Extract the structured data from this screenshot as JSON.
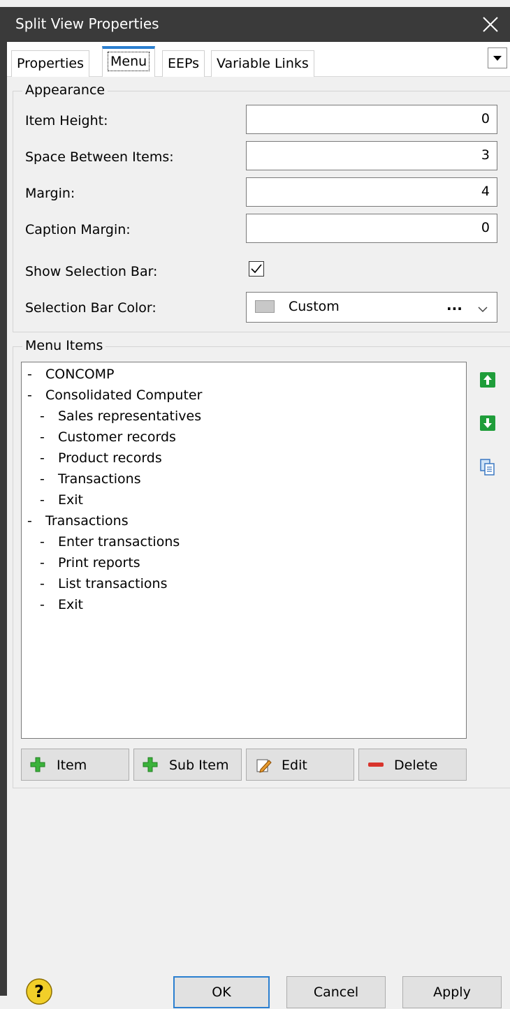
{
  "window": {
    "title": "Split View Properties"
  },
  "tabs": [
    {
      "label": "Properties"
    },
    {
      "label": "Menu"
    },
    {
      "label": "EEPs"
    },
    {
      "label": "Variable Links"
    }
  ],
  "appearance": {
    "group_label": "Appearance",
    "item_height": {
      "label": "Item Height:",
      "value": "0"
    },
    "space_between": {
      "label": "Space Between Items:",
      "value": "3"
    },
    "margin": {
      "label": "Margin:",
      "value": "4"
    },
    "caption_margin": {
      "label": "Caption Margin:",
      "value": "0"
    },
    "show_selection_bar": {
      "label": "Show Selection Bar:",
      "checked": true
    },
    "selection_bar_color": {
      "label": "Selection Bar Color:",
      "value": "Custom",
      "ellipsis": "...",
      "swatch": "#c8c8c8"
    }
  },
  "menu_items": {
    "group_label": "Menu Items",
    "items": [
      {
        "dash": "-",
        "text": "CONCOMP"
      },
      {
        "dash": "-",
        "text": "Consolidated Computer"
      },
      {
        "dash": "-",
        "text": "Sales representatives"
      },
      {
        "dash": "-",
        "text": "Customer records"
      },
      {
        "dash": "-",
        "text": "Product records"
      },
      {
        "dash": "-",
        "text": "Transactions"
      },
      {
        "dash": "-",
        "text": "Exit"
      },
      {
        "dash": "-",
        "text": "Transactions"
      },
      {
        "dash": "-",
        "text": "Enter transactions"
      },
      {
        "dash": "-",
        "text": "Print reports"
      },
      {
        "dash": "-",
        "text": "List transactions"
      },
      {
        "dash": "-",
        "text": "Exit"
      }
    ],
    "buttons": {
      "item": "Item",
      "sub_item": "Sub Item",
      "edit": "Edit",
      "delete": "Delete"
    }
  },
  "footer": {
    "ok": "OK",
    "cancel": "Cancel",
    "apply": "Apply",
    "help_glyph": "?"
  },
  "colors": {
    "titlebar": "#3a3a3a",
    "accent": "#2b7fd0",
    "green_icon": "#1f9d3a",
    "delete_red": "#d8342c"
  }
}
